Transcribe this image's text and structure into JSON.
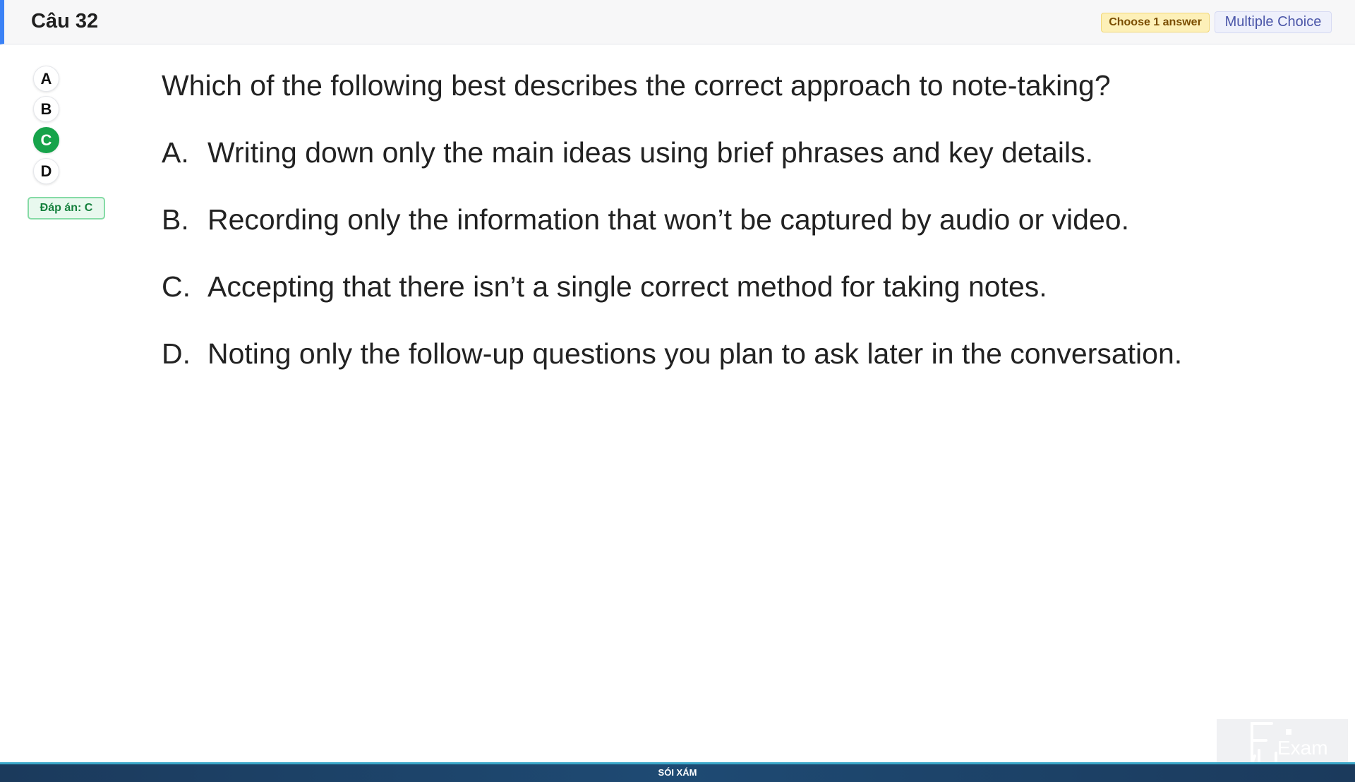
{
  "header": {
    "question_number": "Câu 32",
    "instruction_badge": "Choose 1 answer",
    "type_badge": "Multiple Choice"
  },
  "answer_selector": {
    "options": [
      "A",
      "B",
      "C",
      "D"
    ],
    "selected": "C",
    "answer_label": "Đáp án: C"
  },
  "question": {
    "stem": "Which of the following best describes the correct approach to note-taking?",
    "choices": [
      {
        "letter": "A.",
        "text": "Writing down only the main ideas using brief phrases and key details."
      },
      {
        "letter": "B.",
        "text": "Recording only the information that won’t be captured by audio or video."
      },
      {
        "letter": "C.",
        "text": "Accepting that there isn’t a single correct method for taking notes."
      },
      {
        "letter": "D.",
        "text": "Noting only the follow-up questions you plan to ask later in the conversation."
      }
    ]
  },
  "footer": {
    "label": "SÓI XÁM"
  },
  "watermark": {
    "logo_text": "Exam",
    "icon": "fu-logo-icon"
  },
  "colors": {
    "accent": "#3b82f6",
    "selected_green": "#16a34a",
    "footer_bg": "#1e4a73"
  }
}
